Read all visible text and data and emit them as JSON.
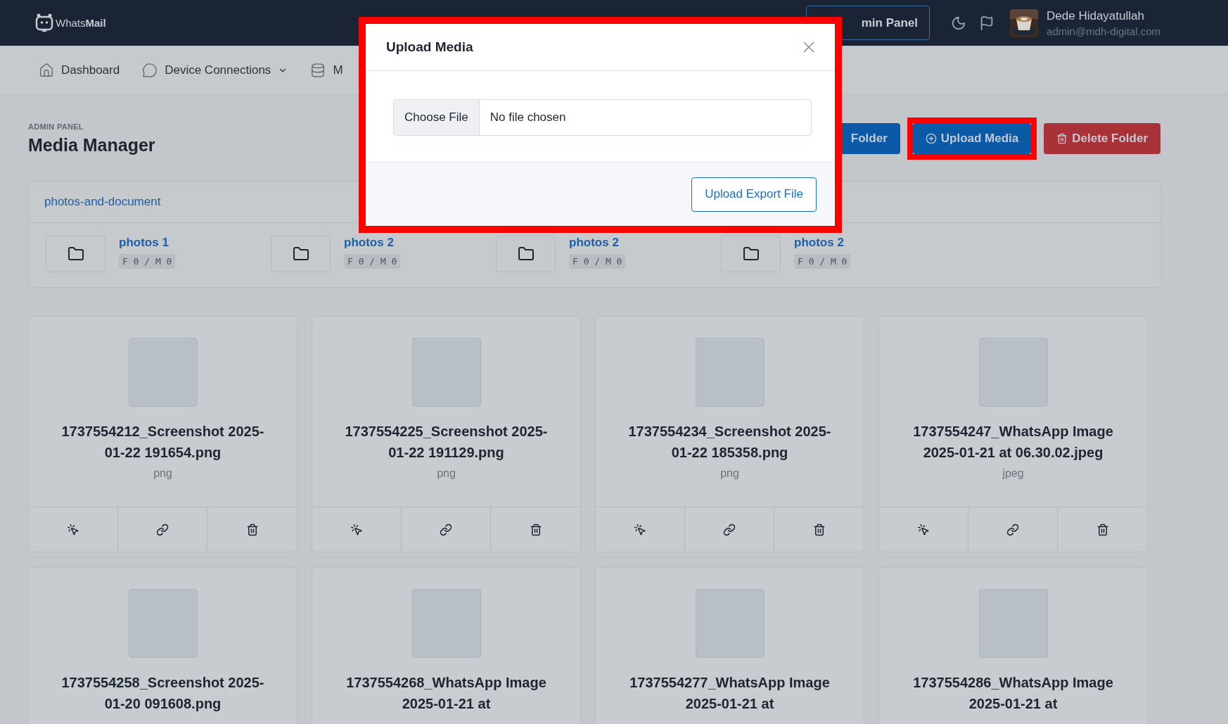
{
  "header": {
    "logo": "Whats**Mail**",
    "admin_button": "min Panel",
    "user": {
      "name": "Dede Hidayatullah",
      "email": "admin@mdh-digital.com"
    }
  },
  "nav": [
    {
      "label": "Dashboard",
      "dropdown": false
    },
    {
      "label": "Device Connections",
      "dropdown": true
    },
    {
      "label": "M",
      "dropdown": false
    }
  ],
  "page": {
    "breadcrumb": "ADMIN PANEL",
    "title": "Media Manager"
  },
  "actions": [
    {
      "label": "Folder",
      "kind": "primary",
      "highlighted": false
    },
    {
      "label": "Upload Media",
      "kind": "primary",
      "highlighted": true
    },
    {
      "label": "Delete Folder",
      "kind": "danger",
      "highlighted": false
    }
  ],
  "folder_panel": {
    "path": "photos-and-document",
    "folders": [
      {
        "name": "photos 1",
        "counts": "F 0 / M 0"
      },
      {
        "name": "photos 2",
        "counts": "F 0 / M 0"
      },
      {
        "name": "photos 2",
        "counts": "F 0 / M 0"
      },
      {
        "name": "photos 2",
        "counts": "F 0 / M 0"
      }
    ]
  },
  "media": [
    {
      "name": "1737554212_Screenshot 2025-01-22 191654.png",
      "type": "png"
    },
    {
      "name": "1737554225_Screenshot 2025-01-22 191129.png",
      "type": "png"
    },
    {
      "name": "1737554234_Screenshot 2025-01-22 185358.png",
      "type": "png"
    },
    {
      "name": "1737554247_WhatsApp Image 2025-01-21 at 06.30.02.jpeg",
      "type": "jpeg"
    },
    {
      "name": "1737554258_Screenshot 2025-01-20 091608.png"
    },
    {
      "name": "1737554268_WhatsApp Image 2025-01-21 at"
    },
    {
      "name": "1737554277_WhatsApp Image 2025-01-21 at"
    },
    {
      "name": "1737554286_WhatsApp Image 2025-01-21 at"
    }
  ],
  "dialog": {
    "title": "Upload Media",
    "file_button": "Choose File",
    "file_status": "No file chosen",
    "submit": "Upload Export File",
    "highlighted": true
  }
}
